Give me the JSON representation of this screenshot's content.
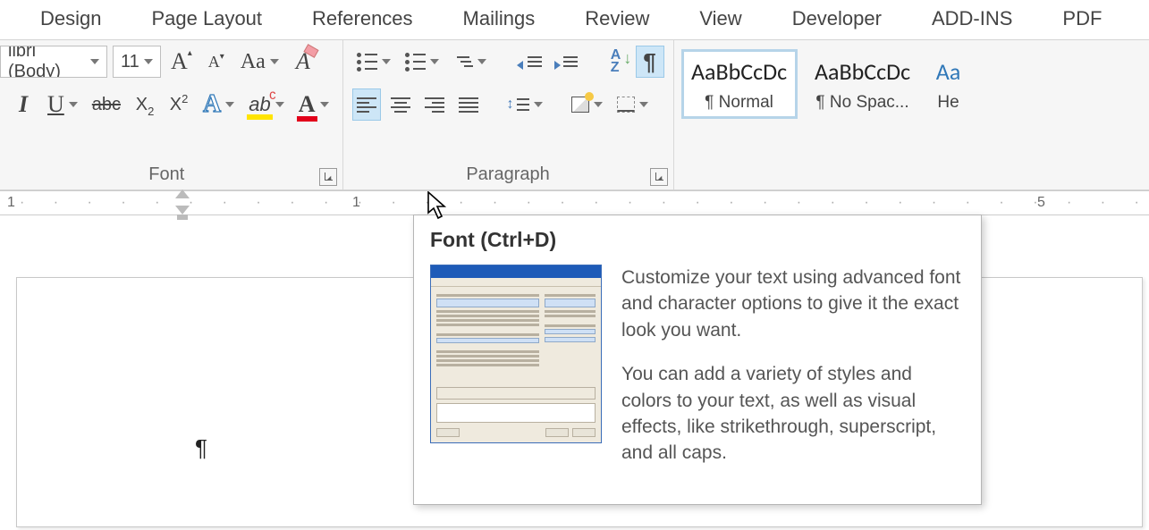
{
  "tabs": {
    "design": "Design",
    "page_layout": "Page Layout",
    "references": "References",
    "mailings": "Mailings",
    "review": "Review",
    "view": "View",
    "developer": "Developer",
    "addins": "ADD-INS",
    "pdf": "PDF"
  },
  "font": {
    "name": "libri (Body)",
    "size": "11",
    "group_label": "Font"
  },
  "paragraph": {
    "group_label": "Paragraph"
  },
  "styles": {
    "preview_text": "AaBbCcDc",
    "normal": "¶ Normal",
    "nospacing": "¶ No Spac...",
    "heading_preview": "Aa",
    "heading": "He"
  },
  "ruler": {
    "one": "1",
    "oneb": "1",
    "five": "5"
  },
  "document": {
    "pilcrow": "¶"
  },
  "tooltip": {
    "title": "Font (Ctrl+D)",
    "p1": "Customize your text using advanced font and character options to give it the exact look you want.",
    "p2": "You can add a variety of styles and colors to your text, as well as visual effects, like strikethrough, superscript, and all caps."
  }
}
